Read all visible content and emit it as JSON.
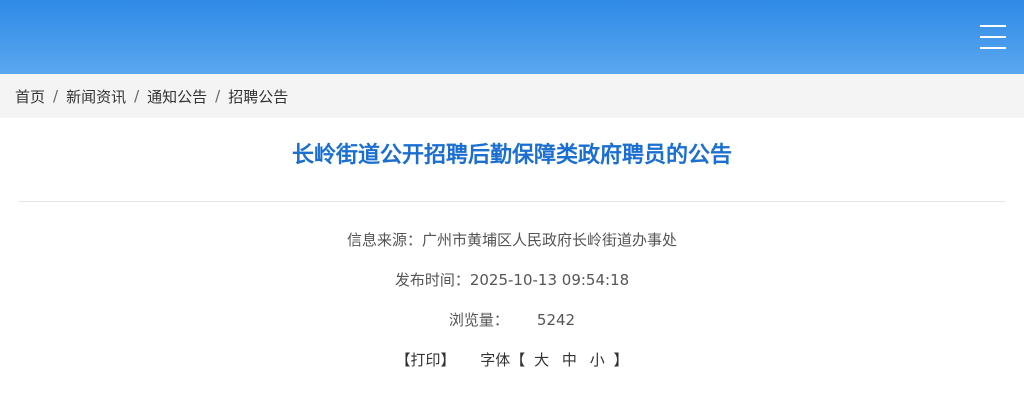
{
  "header": {
    "menu_icon": "hamburger-menu-icon",
    "gradient_top": "#2f8ae6",
    "gradient_bottom": "#5aa7f0"
  },
  "breadcrumb": {
    "items": [
      "首页",
      "新闻资讯",
      "通知公告",
      "招聘公告"
    ],
    "separator": "/"
  },
  "article": {
    "title": "长岭街道公开招聘后勤保障类政府聘员的公告",
    "source_label": "信息来源：",
    "source_value": "广州市黄埔区人民政府长岭街道办事处",
    "time_label": "发布时间：",
    "time_value": "2025-10-13 09:54:18",
    "views_label": "浏览量：",
    "views_value": "5242",
    "print_label": "【打印】",
    "font_label": "字体【",
    "font_large": "大",
    "font_medium": "中",
    "font_small": "小",
    "font_close": "】"
  },
  "colors": {
    "title": "#1a6fd0",
    "breadcrumb_bg": "#f4f4f5"
  }
}
